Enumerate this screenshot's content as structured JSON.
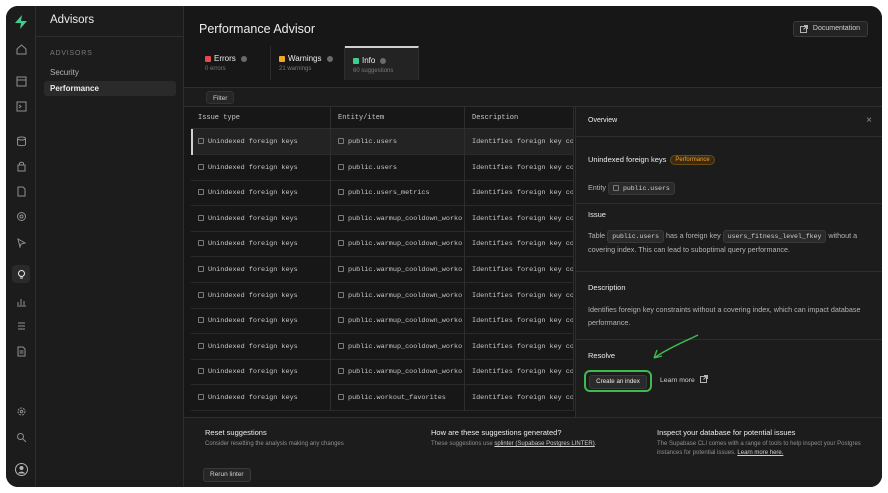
{
  "app": {
    "section_title": "Advisors",
    "page_title": "Performance Advisor"
  },
  "sidebar": {
    "section_label": "ADVISORS",
    "items": [
      {
        "label": "Security",
        "active": false
      },
      {
        "label": "Performance",
        "active": true
      }
    ]
  },
  "header": {
    "documentation_label": "Documentation"
  },
  "tabs": [
    {
      "label": "Errors",
      "sub": "0 errors",
      "color": "#e5484d"
    },
    {
      "label": "Warnings",
      "sub": "21 warnings",
      "color": "#f5a623"
    },
    {
      "label": "Info",
      "sub": "60 suggestions",
      "color": "#3ecf8e",
      "active": true
    }
  ],
  "filter_label": "Filter",
  "table": {
    "columns": [
      "Issue type",
      "Entity/item",
      "Description"
    ],
    "rows": [
      {
        "issue": "Unindexed foreign keys",
        "entity": "public.users",
        "desc": "Identifies foreign key co",
        "selected": true
      },
      {
        "issue": "Unindexed foreign keys",
        "entity": "public.users",
        "desc": "Identifies foreign key co"
      },
      {
        "issue": "Unindexed foreign keys",
        "entity": "public.users_metrics",
        "desc": "Identifies foreign key co"
      },
      {
        "issue": "Unindexed foreign keys",
        "entity": "public.warmup_cooldown_worko",
        "desc": "Identifies foreign key co"
      },
      {
        "issue": "Unindexed foreign keys",
        "entity": "public.warmup_cooldown_worko",
        "desc": "Identifies foreign key co"
      },
      {
        "issue": "Unindexed foreign keys",
        "entity": "public.warmup_cooldown_worko",
        "desc": "Identifies foreign key co"
      },
      {
        "issue": "Unindexed foreign keys",
        "entity": "public.warmup_cooldown_worko",
        "desc": "Identifies foreign key co"
      },
      {
        "issue": "Unindexed foreign keys",
        "entity": "public.warmup_cooldown_worko",
        "desc": "Identifies foreign key co"
      },
      {
        "issue": "Unindexed foreign keys",
        "entity": "public.warmup_cooldown_worko",
        "desc": "Identifies foreign key co"
      },
      {
        "issue": "Unindexed foreign keys",
        "entity": "public.warmup_cooldown_worko",
        "desc": "Identifies foreign key co"
      },
      {
        "issue": "Unindexed foreign keys",
        "entity": "public.workout_favorites",
        "desc": "Identifies foreign key co"
      }
    ]
  },
  "panel": {
    "tab_label": "Overview",
    "close": "×",
    "title": "Unindexed foreign keys",
    "badge": "Performance",
    "entity_label": "Entity",
    "entity_value": "public.users",
    "issue_heading": "Issue",
    "issue_text_1": "Table",
    "issue_table": "public.users",
    "issue_text_2": "has a foreign key",
    "issue_fkey": "users_fitness_level_fkey",
    "issue_text_3": "without a covering index. This can lead to suboptimal query performance.",
    "description_heading": "Description",
    "description_text": "Identifies foreign key constraints without a covering index, which can impact database performance.",
    "resolve_heading": "Resolve",
    "create_index_label": "Create an index",
    "learn_more_label": "Learn more"
  },
  "footer": {
    "reset": {
      "title": "Reset suggestions",
      "text": "Consider resetting the analysis making any changes",
      "button": "Rerun linter"
    },
    "how": {
      "title": "How are these suggestions generated?",
      "text_before": "These suggestions use",
      "link": "splinter (Supabase Postgres LINTER)",
      "text_after": "."
    },
    "inspect": {
      "title": "Inspect your database for potential issues",
      "text": "The Supabase CLI comes with a range of tools to help inspect your Postgres instances for potential issues.",
      "link": "Learn more here."
    }
  },
  "colors": {
    "brand": "#3ecf8e",
    "highlight": "#3fb950",
    "badge": "#f0a030"
  }
}
